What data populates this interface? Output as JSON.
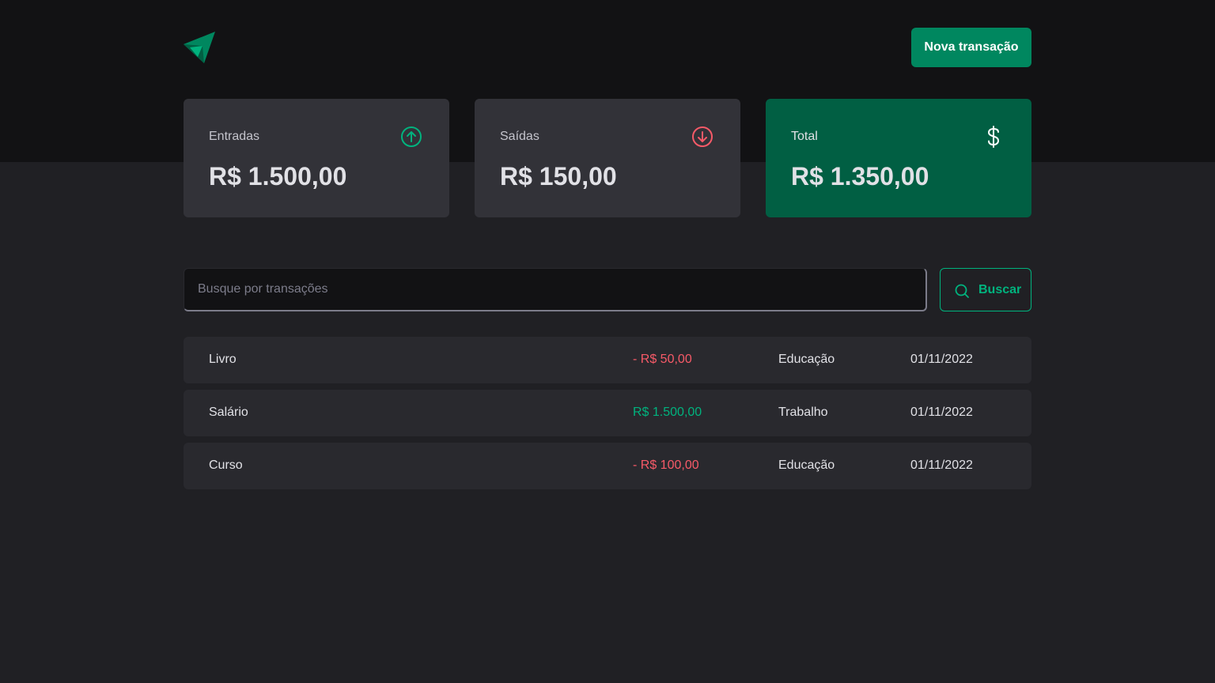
{
  "header": {
    "new_transaction_label": "Nova transação"
  },
  "summary": {
    "income": {
      "label": "Entradas",
      "value": "R$ 1.500,00",
      "icon": "arrow-circle-up-icon"
    },
    "outcome": {
      "label": "Saídas",
      "value": "R$ 150,00",
      "icon": "arrow-circle-down-icon"
    },
    "total": {
      "label": "Total",
      "value": "R$ 1.350,00",
      "icon": "currency-dollar-icon"
    }
  },
  "search": {
    "placeholder": "Busque por transações",
    "value": "",
    "button_label": "Buscar"
  },
  "transactions": [
    {
      "description": "Livro",
      "price": "- R$ 50,00",
      "type": "outcome",
      "category": "Educação",
      "date": "01/11/2022"
    },
    {
      "description": "Salário",
      "price": "R$ 1.500,00",
      "type": "income",
      "category": "Trabalho",
      "date": "01/11/2022"
    },
    {
      "description": "Curso",
      "price": "- R$ 100,00",
      "type": "outcome",
      "category": "Educação",
      "date": "01/11/2022"
    }
  ],
  "colors": {
    "brand": "#00875F",
    "brand_dark": "#015F43",
    "income": "#00B37E",
    "outcome": "#F75A68"
  }
}
